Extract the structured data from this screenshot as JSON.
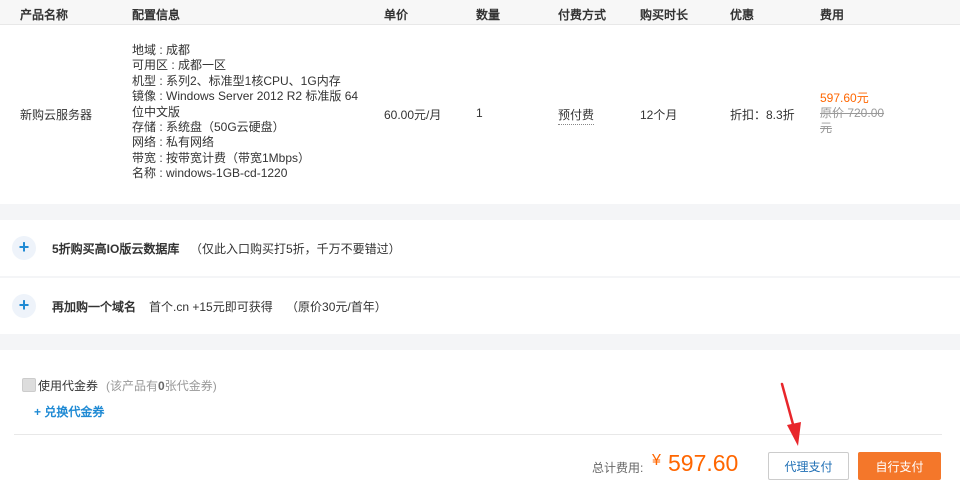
{
  "table": {
    "headers": [
      "产品名称",
      "配置信息",
      "单价",
      "数量",
      "付费方式",
      "购买时长",
      "优惠",
      "费用"
    ],
    "row": {
      "product": "新购云服务器",
      "config": [
        "地域 : 成都",
        "可用区 : 成都一区",
        "机型 : 系列2、标准型1核CPU、1G内存",
        "镜像 : Windows Server 2012 R2 标准版 64",
        "位中文版",
        "存储 : 系统盘（50G云硬盘）",
        "网络 : 私有网络",
        "带宽 : 按带宽计费（带宽1Mbps）",
        "名称 : windows-1GB-cd-1220"
      ],
      "unit_price": "60.00元/月",
      "quantity": "1",
      "payment": "预付费",
      "duration": "12个月",
      "discount": "折扣：8.3折",
      "cost_now": "597.60元",
      "cost_orig_line1": "原价 720.00",
      "cost_orig_line2": "元"
    }
  },
  "promos": [
    {
      "title": "5折购买高IO版云数据库",
      "desc": "（仅此入口购买打5折，千万不要错过）"
    },
    {
      "title": "再加购一个域名",
      "desc": "首个.cn +15元即可获得    （原价30元/首年）"
    }
  ],
  "voucher": {
    "label": "使用代金券",
    "note_prefix": "(该产品有",
    "note_count": "0",
    "note_suffix": "张代金券)",
    "exchange_link": "+ 兑换代金券"
  },
  "total": {
    "label": "总计费用:",
    "currency": "¥",
    "amount": "597.60"
  },
  "buttons": {
    "proxy_pay": "代理支付",
    "self_pay": "自行支付"
  },
  "colors": {
    "accent_orange": "#f4772a",
    "link_blue": "#1f8ad4",
    "arrow_red": "#e8262b"
  }
}
